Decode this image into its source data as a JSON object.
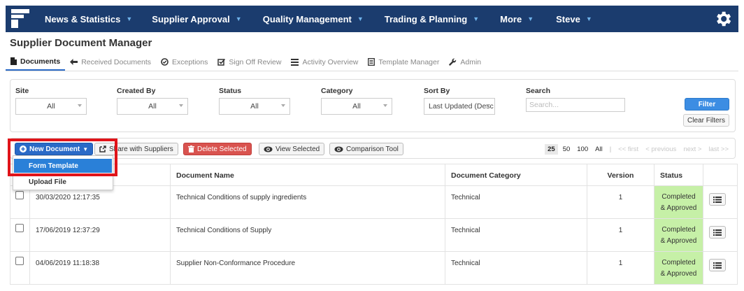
{
  "nav": {
    "items": [
      {
        "label": "News & Statistics"
      },
      {
        "label": "Supplier Approval"
      },
      {
        "label": "Quality Management"
      },
      {
        "label": "Trading & Planning"
      },
      {
        "label": "More"
      },
      {
        "label": "Steve"
      }
    ],
    "icons": {
      "logo": "app-logo",
      "settings": "gear-icon",
      "caret": "caret-down-icon"
    },
    "colors": {
      "bar": "#1b3c6e",
      "caret": "#6fb2ea"
    }
  },
  "page": {
    "title": "Supplier Document Manager"
  },
  "tabs": [
    {
      "label": "Documents",
      "icon": "document-icon",
      "active": true
    },
    {
      "label": "Received Documents",
      "icon": "arrow-left-icon"
    },
    {
      "label": "Exceptions",
      "icon": "check-circle-icon"
    },
    {
      "label": "Sign Off Review",
      "icon": "edit-check-icon"
    },
    {
      "label": "Activity Overview",
      "icon": "list-icon"
    },
    {
      "label": "Template Manager",
      "icon": "template-icon"
    },
    {
      "label": "Admin",
      "icon": "wrench-icon"
    }
  ],
  "filters": {
    "site": {
      "label": "Site",
      "value": "All"
    },
    "created_by": {
      "label": "Created By",
      "value": "All"
    },
    "status": {
      "label": "Status",
      "value": "All"
    },
    "category": {
      "label": "Category",
      "value": "All"
    },
    "sort_by": {
      "label": "Sort By",
      "value": "Last Updated (Desc"
    },
    "search": {
      "label": "Search",
      "placeholder": "Search..."
    },
    "filter_button": "Filter",
    "clear_button": "Clear Filters"
  },
  "toolbar": {
    "new_document": "New Document",
    "share": "Share with Suppliers",
    "delete": "Delete Selected",
    "view_selected": "View Selected",
    "comparison": "Comparison Tool",
    "page_sizes": [
      "25",
      "50",
      "100",
      "All"
    ],
    "active_page_size": "25",
    "pager": {
      "first": "<< first",
      "previous": "< previous",
      "next": "next >",
      "last": "last >>"
    }
  },
  "dropdown": {
    "items": [
      "Form Template",
      "Upload File"
    ],
    "highlighted": "Form Template"
  },
  "table": {
    "columns": [
      "",
      "Document Name",
      "Document Category",
      "Version",
      "Status",
      ""
    ],
    "rows": [
      {
        "date": "30/03/2020 12:17:35",
        "name": "Technical Conditions of supply ingredients",
        "category": "Technical",
        "version": "1",
        "status_line1": "Completed",
        "status_line2": "& Approved"
      },
      {
        "date": "17/06/2019 12:37:29",
        "name": "Technical Conditions of Supply",
        "category": "Technical",
        "version": "1",
        "status_line1": "Completed",
        "status_line2": "& Approved"
      },
      {
        "date": "04/06/2019 11:18:38",
        "name": "Supplier Non-Conformance Procedure",
        "category": "Technical",
        "version": "1",
        "status_line1": "Completed",
        "status_line2": "& Approved"
      }
    ],
    "colors": {
      "status_approved": "#c6f0a7"
    }
  }
}
